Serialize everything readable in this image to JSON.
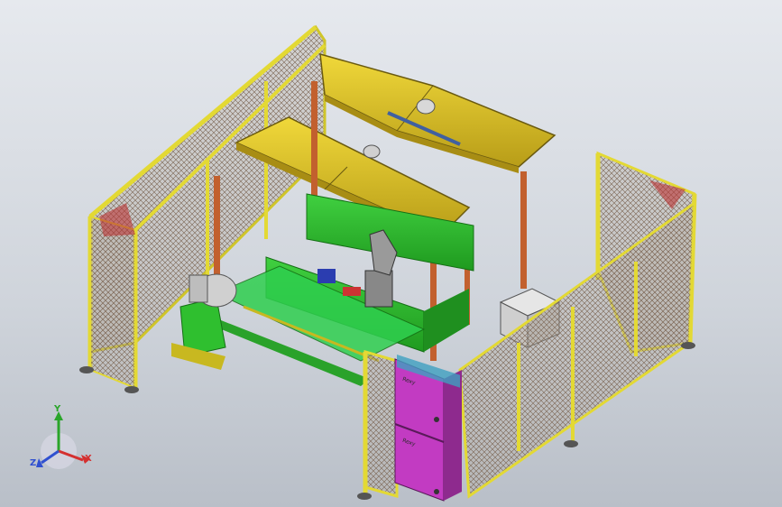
{
  "view": {
    "type": "3D CAD assembly view",
    "background_colors": [
      "#e6e9ee",
      "#b9bfc8"
    ]
  },
  "colors": {
    "fence_frame": "#d9cf2a",
    "mesh": "#8a6f5a",
    "canopy": "#d8c12a",
    "cell_base": "#2fbf2f",
    "magenta_cabinet": "#c23bc2",
    "orange_posts": "#c2602e",
    "axis_x": "#d43030",
    "axis_y": "#2aa52a",
    "axis_z": "#3050d0"
  },
  "triad": {
    "x_label": "X",
    "y_label": "Y",
    "z_label": "Z"
  },
  "cabinet": {
    "upper_label": "Rexy",
    "lower_label": "Rexy"
  }
}
